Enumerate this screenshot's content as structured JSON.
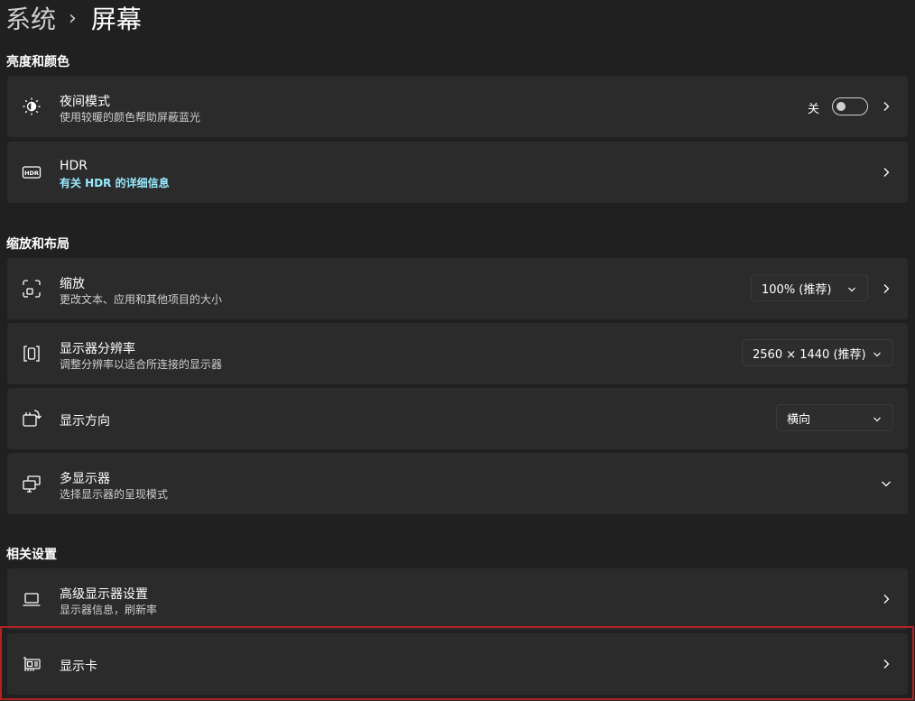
{
  "breadcrumb": {
    "parent": "系统",
    "separator": "›",
    "current": "屏幕"
  },
  "sections": {
    "brightness": "亮度和颜色",
    "scale_layout": "缩放和布局",
    "related": "相关设置"
  },
  "night_light": {
    "title": "夜间模式",
    "desc": "使用较暖的颜色帮助屏蔽蓝光",
    "toggle_label": "关",
    "toggle_on": false,
    "icon": "brightness-icon"
  },
  "hdr": {
    "title": "HDR",
    "link": "有关 HDR 的详细信息",
    "icon": "hdr-icon"
  },
  "scale": {
    "title": "缩放",
    "desc": "更改文本、应用和其他项目的大小",
    "value": "100% (推荐)",
    "icon": "scale-icon"
  },
  "resolution": {
    "title": "显示器分辨率",
    "desc": "调整分辨率以适合所连接的显示器",
    "value": "2560 × 1440 (推荐)",
    "icon": "resolution-icon"
  },
  "orientation": {
    "title": "显示方向",
    "value": "横向",
    "icon": "orientation-icon"
  },
  "multi_display": {
    "title": "多显示器",
    "desc": "选择显示器的呈现模式",
    "icon": "multi-display-icon"
  },
  "advanced_display": {
    "title": "高级显示器设置",
    "desc": "显示器信息，刷新率",
    "icon": "laptop-icon"
  },
  "graphics": {
    "title": "显示卡",
    "icon": "graphics-card-icon"
  },
  "colors": {
    "background": "#202020",
    "card": "#2b2b2b",
    "link": "#99ebff",
    "highlight": "#b32222"
  }
}
